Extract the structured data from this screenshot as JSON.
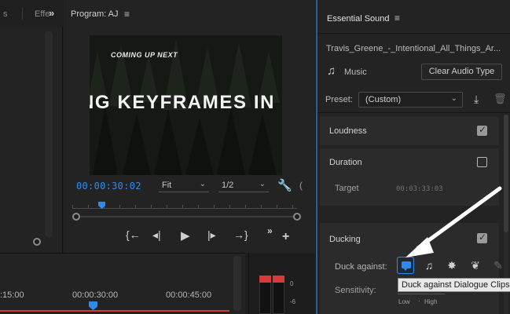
{
  "left_panel": {
    "tab_1": "s",
    "tab_2": "Effe",
    "more": "»"
  },
  "program": {
    "title": "Program: AJ",
    "menu_icon": "≡",
    "video": {
      "coming_up": "COMING UP NEXT",
      "headline": "NG KEYFRAMES IN PREMI"
    },
    "timecode": "00:00:30:02",
    "zoom": "Fit",
    "resolution": "1/2",
    "controls": [
      "step-to-in-icon",
      "step-back-icon",
      "play-icon",
      "step-forward-icon",
      "step-to-out-icon",
      "more-icon",
      "add-icon"
    ]
  },
  "essential_sound": {
    "title": "Essential Sound",
    "menu_icon": "≡",
    "file_name": "Travis_Greene_-_Intentional_All_Things_Ar...",
    "type_label": "Music",
    "clear_button": "Clear Audio Type",
    "preset_label": "Preset:",
    "preset_value": "(Custom)",
    "sections": {
      "loudness": {
        "title": "Loudness",
        "checked": true
      },
      "duration": {
        "title": "Duration",
        "checked": false,
        "target_label": "Target",
        "target_value": "00:03:33:03"
      },
      "ducking": {
        "title": "Ducking",
        "checked": true,
        "duck_against_label": "Duck against:",
        "duck_buttons": [
          "dialogue-icon",
          "music-icon",
          "sfx-icon",
          "ambience-icon",
          "unclassified-icon"
        ],
        "tooltip": "Duck against Dialogue Clips",
        "sensitivity_label": "Sensitivity:",
        "low_label": "Low",
        "high_label": "High"
      }
    }
  },
  "timeline": {
    "ticks": [
      ":15:00",
      "00:00:30:00",
      "00:00:45:00"
    ]
  },
  "meters": {
    "scale": [
      "0",
      "-6"
    ]
  },
  "colors": {
    "accent": "#2d8ceb",
    "peak_red": "#d63a3a",
    "panel": "#232323"
  }
}
